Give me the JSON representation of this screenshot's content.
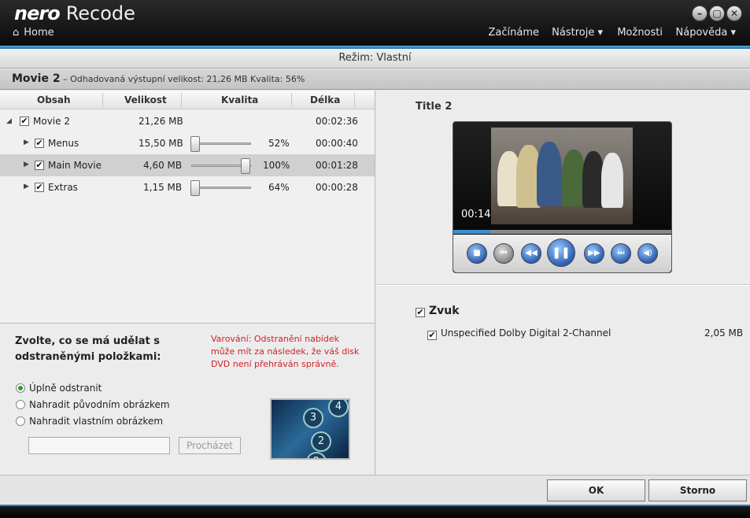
{
  "app": {
    "logo": "nero",
    "name": "Recode"
  },
  "window_controls": {
    "minimize": "–",
    "restore": "▢",
    "close": "✕"
  },
  "nav": {
    "home": "Home",
    "menus": [
      "Začínáme",
      "Nástroje ▾",
      "Možnosti",
      "Nápověda ▾"
    ]
  },
  "mode": "Režim: Vlastní",
  "info": {
    "title": "Movie 2",
    "detail": "– Odhadovaná výstupní velikost: 21,26 MB   Kvalita: 56%"
  },
  "table": {
    "headers": [
      "Obsah",
      "Velikost",
      "Kvalita",
      "Délka"
    ],
    "rows": [
      {
        "name": "Movie 2",
        "size": "21,26 MB",
        "quality": "",
        "length": "00:02:36",
        "quality_level": null
      },
      {
        "name": "Menus",
        "size": "15,50 MB",
        "quality": "52%",
        "length": "00:00:40",
        "quality_level": 0
      },
      {
        "name": "Main Movie",
        "size": "4,60 MB",
        "quality": "100%",
        "length": "00:01:28",
        "quality_level": 1
      },
      {
        "name": "Extras",
        "size": "1,15 MB",
        "quality": "64%",
        "length": "00:00:28",
        "quality_level": 0
      }
    ]
  },
  "removed": {
    "question": "Zvolte, co se má udělat s odstraněnými položkami:",
    "warning": "Varování: Odstranění nabídek může mít za následek, že váš disk DVD není přehráván správně.",
    "options": [
      "Úplně odstranit",
      "Nahradit původním obrázkem",
      "Nahradit vlastním obrázkem"
    ],
    "selected": "Úplně odstranit",
    "browse": "Procházet",
    "path_value": ""
  },
  "preview": {
    "title": "Title 2",
    "time": "00:14",
    "progress": 0.17
  },
  "audio": {
    "heading": "Zvuk",
    "tracks": [
      {
        "name": "Unspecified Dolby Digital 2-Channel",
        "size": "2,05 MB"
      }
    ]
  },
  "buttons": {
    "ok": "OK",
    "cancel": "Storno"
  },
  "colors": {
    "accent": "#2a7fbf",
    "warning": "#d0202a"
  }
}
